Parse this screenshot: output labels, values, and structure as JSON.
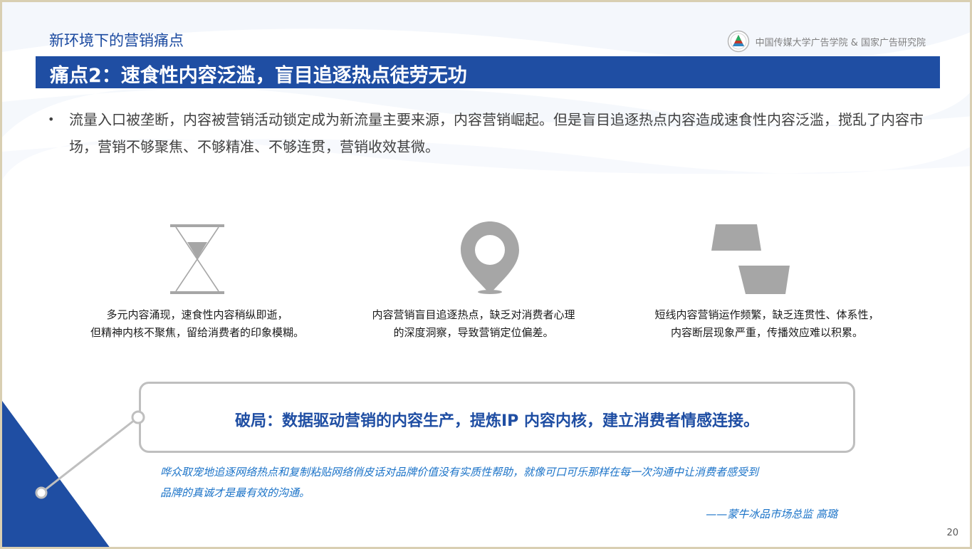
{
  "header": {
    "section_title": "新环境下的营销痛点",
    "organization": "中国传媒大学广告学院 & 国家广告研究院"
  },
  "title_bar": {
    "text": "痛点2：速食性内容泛滥，盲目追逐热点徒劳无功"
  },
  "bullet": {
    "text": "流量入口被垄断，内容被营销活动锁定成为新流量主要来源，内容营销崛起。但是盲目追逐热点内容造成速食性内容泛滥，搅乱了内容市场，营销不够聚焦、不够精准、不够连贯，营销收效甚微。"
  },
  "cards": [
    {
      "icon": "hourglass-icon",
      "line1": "多元内容涌现，速食性内容稍纵即逝，",
      "line2": "但精神内核不聚焦，留给消费者的印象模糊。"
    },
    {
      "icon": "map-pin-icon",
      "line1": "内容营销盲目追逐热点，缺乏对消费者心理",
      "line2": "的深度洞察，导致营销定位偏差。"
    },
    {
      "icon": "broken-shapes-icon",
      "line1": "短线内容营销运作频繁，缺乏连贯性、体系性，",
      "line2": "内容断层现象严重，传播效应难以积累。"
    }
  ],
  "callout": {
    "text": "破局：数据驱动营销的内容生产，提炼IP 内容内核，建立消费者情感连接。"
  },
  "quote": {
    "line1": "哗众取宠地追逐网络热点和复制粘贴网络俏皮话对品牌价值没有实质性帮助，就像可口可乐那样在每一次沟通中让消费者感受到",
    "line2": "品牌的真诚才是最有效的沟通。",
    "attribution": "——蒙牛冰品市场总监 高璐"
  },
  "page_number": "20",
  "colors": {
    "brand_blue": "#1f4ea3",
    "quote_blue": "#1b73c8",
    "icon_gray": "#a6a6a6",
    "frame_beige": "#d9cfb2"
  }
}
